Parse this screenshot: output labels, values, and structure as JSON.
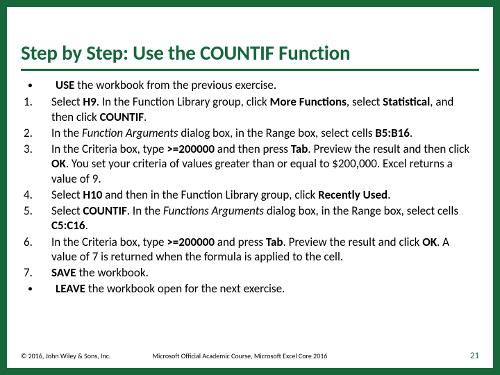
{
  "title": "Step by Step: Use the COUNTIF Function",
  "items": [
    {
      "marker": "•",
      "type": "bullet",
      "html": "<b>USE</b> the workbook from the previous exercise."
    },
    {
      "marker": "1.",
      "type": "num",
      "html": "Select <b>H9</b>. In the Function Library group, click <b>More Functions</b>, select <b>Statistical</b>, and then click <b>COUNTIF</b>."
    },
    {
      "marker": "2.",
      "type": "num",
      "html": "In the <i>Function Arguments</i> dialog box, in the Range box, select cells <b>B5:B16</b>."
    },
    {
      "marker": "3.",
      "type": "num",
      "html": "In the Criteria box, type <b>&gt;=200000</b> and then press <b>Tab</b>. Preview the result and then click <b>OK</b>. You set your criteria of values greater than or equal to $200,000. Excel returns a value of 9."
    },
    {
      "marker": "4.",
      "type": "num",
      "html": "Select <b>H10</b> and then in the Function Library group, click <b>Recently Used</b>."
    },
    {
      "marker": "5.",
      "type": "num",
      "html": "Select <b>COUNTIF</b>. In the <i>Functions Arguments</i> dialog box, in the Range box, select cells <b>C5:C16</b>."
    },
    {
      "marker": "6.",
      "type": "num",
      "html": "In the Criteria box, type <b>&gt;=200000</b> and press <b>Tab</b>. Preview the result and click <b>OK</b>. A value of 7 is returned when the formula is applied to the cell."
    },
    {
      "marker": "7.",
      "type": "num",
      "html": "<b>SAVE</b> the workbook."
    },
    {
      "marker": "•",
      "type": "bullet",
      "html": "<b>LEAVE</b> the workbook open for the next exercise."
    }
  ],
  "footer": {
    "left": "© 2016, John Wiley & Sons, Inc.",
    "mid": "Microsoft Official Academic Course, Microsoft Excel Core 2016",
    "page": "21"
  }
}
